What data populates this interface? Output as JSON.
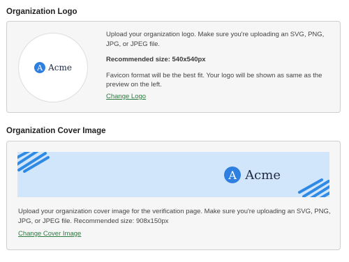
{
  "logo_section": {
    "title": "Organization Logo",
    "description": "Upload your organization logo. Make sure you're uploading an SVG, PNG, JPG, or JPEG file.",
    "recommended": "Recommended size: 540x540px",
    "note": "Favicon format will be the best fit. Your logo will be shown as same as the preview on the left.",
    "change_link": "Change Logo",
    "preview_brand": {
      "mark": "A",
      "name": "Acme",
      "color": "#2f7fe0"
    }
  },
  "cover_section": {
    "title": "Organization Cover Image",
    "preview_brand": {
      "mark": "A",
      "name": "Acme",
      "color": "#2f7fe0"
    },
    "preview_background": "#d2e6fb",
    "description": "Upload your organization cover image for the verification page. Make sure you're uploading an SVG, PNG, JPG, or JPEG file. Recommended size: 908x150px",
    "change_link": "Change Cover Image"
  },
  "colors": {
    "link": "#2b7a3e",
    "accent": "#2f7fe0"
  }
}
